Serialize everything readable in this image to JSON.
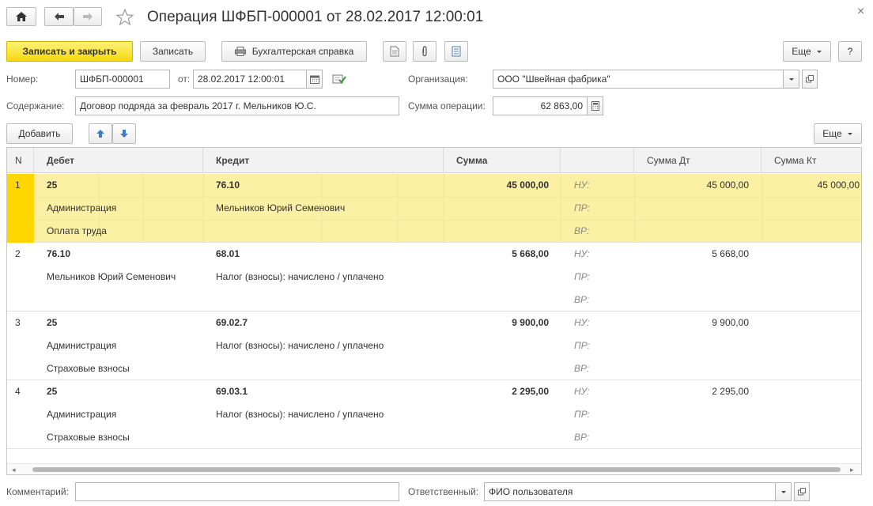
{
  "window": {
    "title": "Операция ШФБП-000001 от 28.02.2017 12:00:01",
    "close_glyph": "×"
  },
  "toolbar": {
    "save_close": "Записать и закрыть",
    "save": "Записать",
    "report": "Бухгалтерская справка",
    "more": "Еще",
    "help": "?"
  },
  "form": {
    "number_label": "Номер:",
    "number_value": "ШФБП-000001",
    "from_label": "от:",
    "date_value": "28.02.2017 12:00:01",
    "org_label": "Организация:",
    "org_value": "ООО \"Швейная фабрика\"",
    "content_label": "Содержание:",
    "content_value": "Договор подряда за февраль 2017 г. Мельников Ю.С.",
    "sum_label": "Сумма операции:",
    "sum_value": "62 863,00"
  },
  "table_toolbar": {
    "add": "Добавить",
    "more": "Еще"
  },
  "table": {
    "headers": {
      "n": "N",
      "debit": "Дебет",
      "credit": "Кредит",
      "sum": "Сумма",
      "sum_dt": "Сумма Дт",
      "sum_kt": "Сумма Кт"
    },
    "rows": [
      {
        "n": "1",
        "debit": "25",
        "debit_sub1": "Администрация",
        "debit_sub2": "Оплата труда",
        "credit": "76.10",
        "credit_sub1": "Мельников Юрий Семенович",
        "credit_sub2": "",
        "sum": "45 000,00",
        "nu": "НУ:",
        "pr": "ПР:",
        "vr": "ВР:",
        "sum_dt": "45 000,00",
        "sum_kt": "45 000,00"
      },
      {
        "n": "2",
        "debit": "76.10",
        "debit_sub1": "Мельников Юрий Семенович",
        "debit_sub2": "",
        "credit": "68.01",
        "credit_sub1": "Налог (взносы): начислено / уплачено",
        "credit_sub2": "",
        "sum": "5 668,00",
        "nu": "НУ:",
        "pr": "ПР:",
        "vr": "ВР:",
        "sum_dt": "5 668,00",
        "sum_kt": ""
      },
      {
        "n": "3",
        "debit": "25",
        "debit_sub1": "Администрация",
        "debit_sub2": "Страховые взносы",
        "credit": "69.02.7",
        "credit_sub1": "Налог (взносы): начислено / уплачено",
        "credit_sub2": "",
        "sum": "9 900,00",
        "nu": "НУ:",
        "pr": "ПР:",
        "vr": "ВР:",
        "sum_dt": "9 900,00",
        "sum_kt": ""
      },
      {
        "n": "4",
        "debit": "25",
        "debit_sub1": "Администрация",
        "debit_sub2": "Страховые взносы",
        "credit": "69.03.1",
        "credit_sub1": "Налог (взносы): начислено / уплачено",
        "credit_sub2": "",
        "sum": "2 295,00",
        "nu": "НУ:",
        "pr": "ПР:",
        "vr": "ВР:",
        "sum_dt": "2 295,00",
        "sum_kt": ""
      }
    ]
  },
  "footer": {
    "comment_label": "Комментарий:",
    "comment_value": "",
    "responsible_label": "Ответственный:",
    "responsible_value": "ФИО пользователя"
  },
  "icons": {
    "home": "home-icon",
    "back": "arrow-left-icon",
    "forward": "arrow-right-icon",
    "star": "star-icon",
    "print": "printer-icon",
    "doc": "document-icon",
    "clip": "paperclip-icon",
    "list": "list-icon",
    "calendar": "calendar-icon",
    "check": "check-icon",
    "dropdown": "chevron-down-icon",
    "open": "open-icon",
    "calculator": "calculator-icon",
    "up": "arrow-up-icon",
    "down": "arrow-down-icon"
  },
  "colors": {
    "primary_button": "#f5d90e",
    "selected_row": "#fbf0a3",
    "selected_marker": "#ffd600"
  }
}
